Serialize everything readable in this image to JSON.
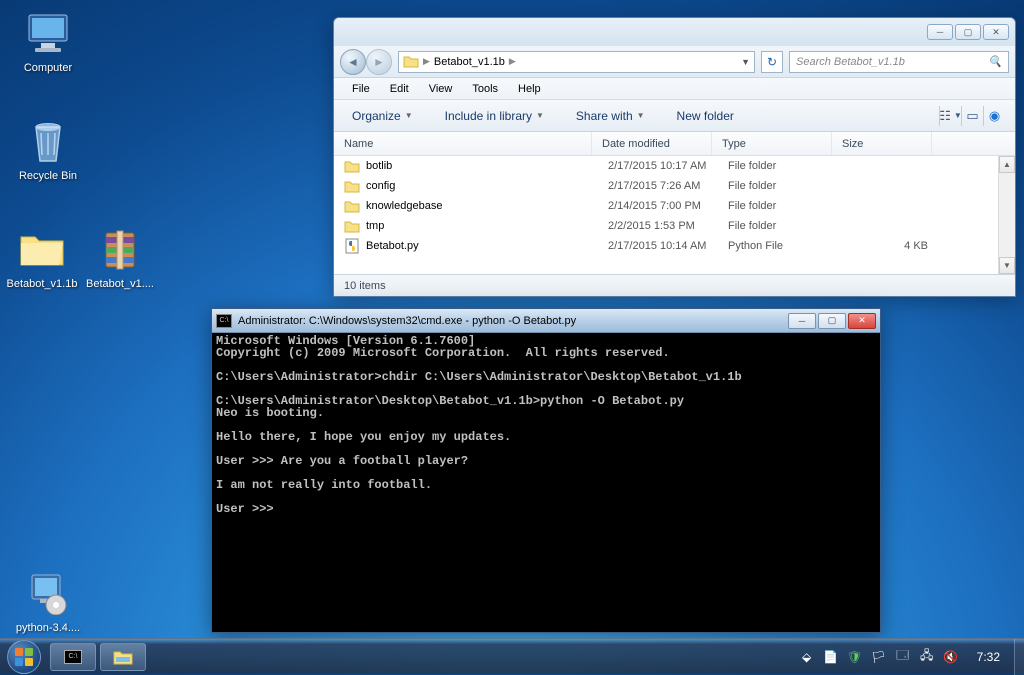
{
  "desktop": {
    "icons": [
      {
        "label": "Computer",
        "kind": "computer"
      },
      {
        "label": "Recycle Bin",
        "kind": "recyclebin"
      },
      {
        "label": "Betabot_v1.1b",
        "kind": "folder"
      },
      {
        "label": "Betabot_v1....",
        "kind": "rar"
      },
      {
        "label": "python-3.4....",
        "kind": "installer"
      }
    ]
  },
  "explorer": {
    "breadcrumb": [
      "Betabot_v1.1b"
    ],
    "search_placeholder": "Search Betabot_v1.1b",
    "menus": [
      "File",
      "Edit",
      "View",
      "Tools",
      "Help"
    ],
    "toolbar": {
      "organize": "Organize",
      "include": "Include in library",
      "share": "Share with",
      "newfolder": "New folder"
    },
    "columns": {
      "name": "Name",
      "date": "Date modified",
      "type": "Type",
      "size": "Size"
    },
    "rows": [
      {
        "name": "botlib",
        "date": "2/17/2015 10:17 AM",
        "type": "File folder",
        "size": "",
        "icon": "folder"
      },
      {
        "name": "config",
        "date": "2/17/2015 7:26 AM",
        "type": "File folder",
        "size": "",
        "icon": "folder"
      },
      {
        "name": "knowledgebase",
        "date": "2/14/2015 7:00 PM",
        "type": "File folder",
        "size": "",
        "icon": "folder"
      },
      {
        "name": "tmp",
        "date": "2/2/2015 1:53 PM",
        "type": "File folder",
        "size": "",
        "icon": "folder"
      },
      {
        "name": "Betabot.py",
        "date": "2/17/2015 10:14 AM",
        "type": "Python File",
        "size": "4 KB",
        "icon": "python"
      }
    ],
    "status": "10 items"
  },
  "cmd": {
    "title": "Administrator: C:\\Windows\\system32\\cmd.exe - python  -O Betabot.py",
    "lines": [
      "Microsoft Windows [Version 6.1.7600]",
      "Copyright (c) 2009 Microsoft Corporation.  All rights reserved.",
      "",
      "C:\\Users\\Administrator>chdir C:\\Users\\Administrator\\Desktop\\Betabot_v1.1b",
      "",
      "C:\\Users\\Administrator\\Desktop\\Betabot_v1.1b>python -O Betabot.py",
      "Neo is booting.",
      "",
      "Hello there, I hope you enjoy my updates.",
      "",
      "User >>> Are you a football player?",
      "",
      "I am not really into football.",
      "",
      "User >>> "
    ]
  },
  "taskbar": {
    "clock": "7:32"
  }
}
